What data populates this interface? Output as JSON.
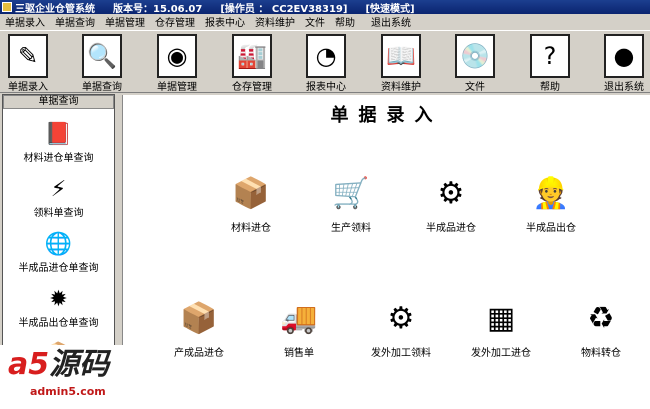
{
  "titlebar": {
    "app": "三驱企业仓管系统",
    "version": "版本号：15.06.07",
    "operator": "[操作员 ： CC2EV38319]",
    "mode": "[快速模式]"
  },
  "menu": [
    "单据录入",
    "单据查询",
    "单据管理",
    "仓存管理",
    "报表中心",
    "资料维护",
    "文件",
    "帮助",
    "退出系统"
  ],
  "toolbar": [
    {
      "label": "单据录入",
      "icon": "✎"
    },
    {
      "label": "单据查询",
      "icon": "🔍"
    },
    {
      "label": "单据管理",
      "icon": "◉"
    },
    {
      "label": "仓存管理",
      "icon": "🏭"
    },
    {
      "label": "报表中心",
      "icon": "◔"
    },
    {
      "label": "资料维护",
      "icon": "📖"
    },
    {
      "label": "文件",
      "icon": "💿"
    },
    {
      "label": "帮助",
      "icon": "?"
    },
    {
      "label": "退出系统",
      "icon": "●"
    }
  ],
  "left": {
    "header": "单据查询",
    "items": [
      {
        "label": "材料进仓单查询",
        "icon": "📕"
      },
      {
        "label": "领料单查询",
        "icon": "⚡"
      },
      {
        "label": "半成品进仓单查询",
        "icon": "🌐"
      },
      {
        "label": "半成品出仓单查询",
        "icon": "✹"
      },
      {
        "label": "",
        "icon": "📦"
      }
    ]
  },
  "main": {
    "title": "单据录入",
    "items": [
      {
        "label": "材料进仓",
        "icon": "📦"
      },
      {
        "label": "生产领料",
        "icon": "🛒"
      },
      {
        "label": "半成品进仓",
        "icon": "⚙"
      },
      {
        "label": "半成品出仓",
        "icon": "👷"
      },
      {
        "label": "产成品进仓",
        "icon": "📦"
      },
      {
        "label": "销售单",
        "icon": "🚚"
      },
      {
        "label": "发外加工领料",
        "icon": "⚙"
      },
      {
        "label": "发外加工进仓",
        "icon": "▦"
      },
      {
        "label": "物料转仓",
        "icon": "♻"
      }
    ]
  },
  "watermark": {
    "logo": "a5源码",
    "domain": "admin5.com"
  }
}
